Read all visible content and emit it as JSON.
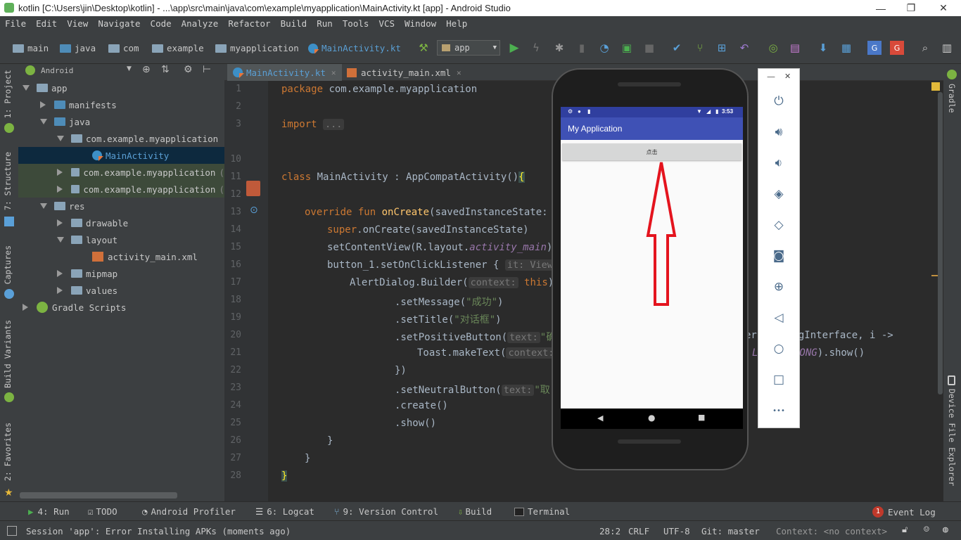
{
  "window": {
    "title": "kotlin [C:\\Users\\jin\\Desktop\\kotlin] - ...\\app\\src\\main\\java\\com\\example\\myapplication\\MainActivity.kt [app] - Android Studio",
    "minimize": "—",
    "maximize": "❐",
    "close": "✕"
  },
  "menu": [
    "File",
    "Edit",
    "View",
    "Navigate",
    "Code",
    "Analyze",
    "Refactor",
    "Build",
    "Run",
    "Tools",
    "VCS",
    "Window",
    "Help"
  ],
  "breadcrumbs": [
    "main",
    "java",
    "com",
    "example",
    "myapplication",
    "MainActivity.kt"
  ],
  "run_config": "app",
  "left_tabs": [
    "1: Project",
    "7: Structure",
    "Captures",
    "Build Variants",
    "2: Favorites"
  ],
  "right_tabs": [
    "Gradle",
    "Device File Explorer"
  ],
  "project": {
    "view": "Android",
    "tree": [
      {
        "label": "app",
        "expanded": true
      },
      {
        "label": "manifests",
        "expanded": false
      },
      {
        "label": "java",
        "expanded": true
      },
      {
        "label": "com.example.myapplication",
        "expanded": true
      },
      {
        "label": "MainActivity",
        "selected": true
      },
      {
        "label": "com.example.myapplication",
        "suffix": "(",
        "expanded": false
      },
      {
        "label": "com.example.myapplication",
        "suffix": "(",
        "expanded": false
      },
      {
        "label": "res",
        "expanded": true
      },
      {
        "label": "drawable",
        "expanded": false
      },
      {
        "label": "layout",
        "expanded": true
      },
      {
        "label": "activity_main.xml"
      },
      {
        "label": "mipmap",
        "expanded": false
      },
      {
        "label": "values",
        "expanded": false
      },
      {
        "label": "Gradle Scripts",
        "expanded": false
      }
    ]
  },
  "editor": {
    "tabs": [
      {
        "label": "MainActivity.kt",
        "active": true
      },
      {
        "label": "activity_main.xml",
        "active": false
      }
    ],
    "line_numbers": [
      "1",
      "2",
      "3",
      "10",
      "11",
      "12",
      "13",
      "14",
      "15",
      "16",
      "17",
      "18",
      "19",
      "20",
      "21",
      "22",
      "23",
      "24",
      "25",
      "26",
      "27",
      "28"
    ]
  },
  "code": {
    "l1_kw": "package",
    "l1_rest": " com.example.myapplication",
    "l3_kw": "import",
    "l3_fold": "...",
    "l11_kw": "class",
    "l11_rest": " MainActivity : AppCompatActivity()",
    "l11_brace": "{",
    "l13_kw": "override fun",
    "l13_fn": " onCreate",
    "l13_rest": "(savedInstanceState: Bu",
    "l14_kw": "super",
    "l14_rest": ".onCreate(savedInstanceState)",
    "l15_a": "setContentView(R.layout.",
    "l15_it": "activity_main",
    "l15_b": ")",
    "l16_a": "button_1.setOnClickListener ",
    "l16_b": "{",
    "l16_hint": "it: View!",
    "l17_a": "AlertDialog.Builder(",
    "l17_hint": "context:",
    "l17_this": " this",
    "l17_b": ")",
    "l18_a": ".setMessage(",
    "l18_str": "\"成功\"",
    "l18_b": ")",
    "l19_a": ".setTitle(",
    "l19_str": "\"对话框\"",
    "l19_b": ")",
    "l20_a": ".setPositiveButton(",
    "l20_hint": "text:",
    "l20_str": "\"确",
    "l20_tail": "er: DialogInterface, i ->",
    "l21_a": "Toast.makeText(",
    "l21_hint": "context:",
    "l21_it": "LENGTH_LONG",
    "l21_tail": ").show()",
    "l22": "})",
    "l23_a": ".setNeutralButton(",
    "l23_hint": "text:",
    "l23_str": "\"取",
    "l24": ".create()",
    "l25": ".show()",
    "l26": "}",
    "l27": "}",
    "l28": "}"
  },
  "emulator": {
    "status_time": "3:53",
    "app_title": "My Application",
    "button_label": "点击",
    "arrow_color": "#e4141e",
    "panel_min": "—",
    "panel_close": "✕",
    "panel_more": "•••"
  },
  "bottom_tools": [
    "4: Run",
    "TODO",
    "Android Profiler",
    "6: Logcat",
    "9: Version Control",
    "Build",
    "Terminal"
  ],
  "event_log": {
    "count": "1",
    "label": "Event Log"
  },
  "status": {
    "message": "Session 'app': Error Installing APKs (moments ago)",
    "position": "28:2",
    "line_sep": "CRLF",
    "encoding": "UTF-8",
    "git": "Git: master",
    "context": "Context: <no context>"
  }
}
